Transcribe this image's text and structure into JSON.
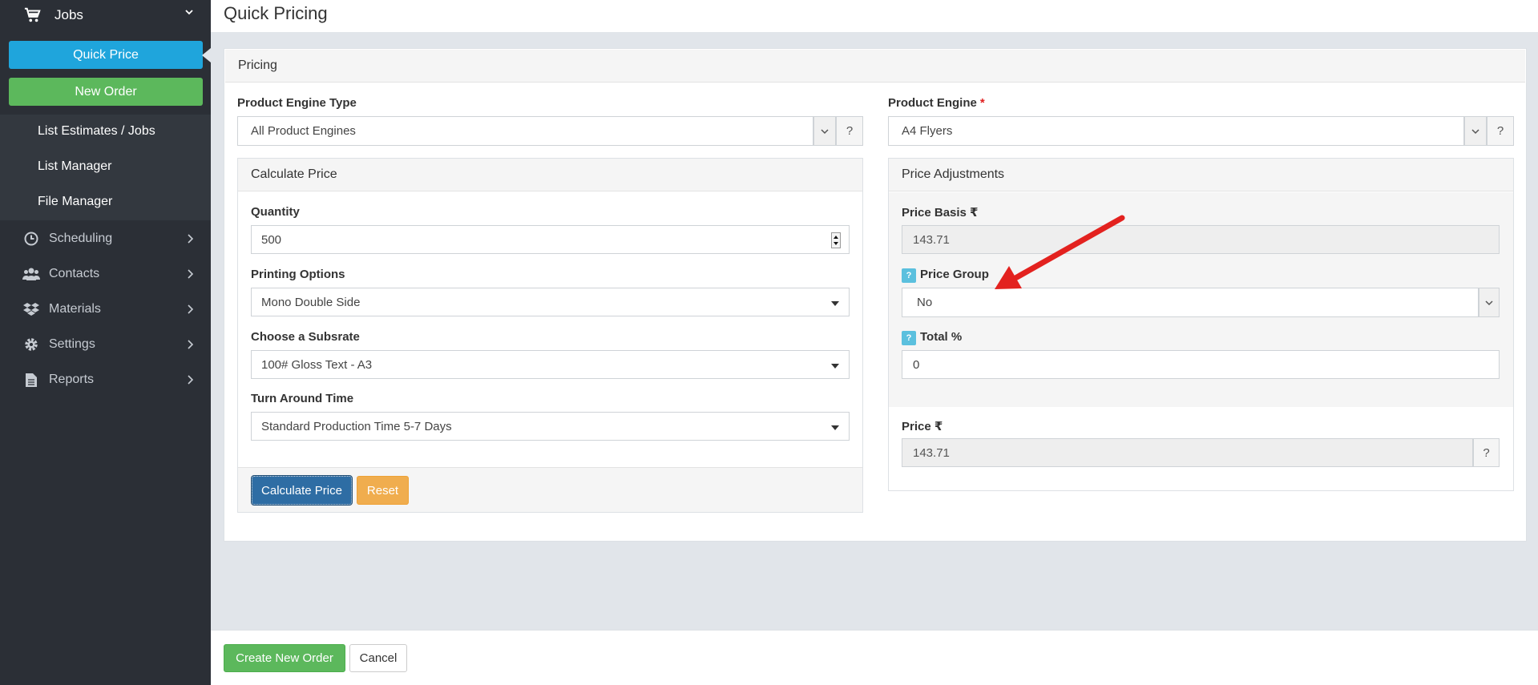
{
  "sidebar": {
    "jobs_label": "Jobs",
    "quick_price_label": "Quick Price",
    "new_order_label": "New Order",
    "sub_items": [
      "List Estimates / Jobs",
      "List Manager",
      "File Manager"
    ],
    "items": [
      {
        "label": "Scheduling",
        "icon": "clock-icon"
      },
      {
        "label": "Contacts",
        "icon": "users-icon"
      },
      {
        "label": "Materials",
        "icon": "dropbox-icon"
      },
      {
        "label": "Settings",
        "icon": "gear-icon"
      },
      {
        "label": "Reports",
        "icon": "document-icon"
      }
    ]
  },
  "header": {
    "title": "Quick Pricing"
  },
  "pricing": {
    "panel_title": "Pricing",
    "engine_type_label": "Product Engine Type",
    "engine_type_value": "All Product Engines",
    "engine_label": "Product Engine",
    "engine_required": "*",
    "engine_value": "A4 Flyers",
    "help_symbol": "?"
  },
  "calculate": {
    "title": "Calculate Price",
    "quantity_label": "Quantity",
    "quantity_value": "500",
    "printing_label": "Printing Options",
    "printing_value": "Mono Double Side",
    "substrate_label": "Choose a Subsrate",
    "substrate_value": "100# Gloss Text - A3",
    "turnaround_label": "Turn Around Time",
    "turnaround_value": "Standard Production Time 5-7 Days",
    "calc_button": "Calculate Price",
    "reset_button": "Reset"
  },
  "adjustments": {
    "title": "Price Adjustments",
    "price_basis_label": "Price Basis ₹",
    "price_basis_value": "143.71",
    "price_group_label": "Price Group",
    "price_group_value": "No",
    "total_label": "Total %",
    "total_value": "0",
    "price_label": "Price ₹",
    "price_value": "143.71",
    "help_badge": "?"
  },
  "footer": {
    "create_button": "Create New Order",
    "cancel_button": "Cancel"
  },
  "colors": {
    "sidebar_bg": "#2b2f36",
    "quick_price": "#1fa5dc",
    "new_order": "#5cb85c",
    "primary": "#2e6da4",
    "warning": "#f0ad4e",
    "info": "#5bc0de",
    "annotation": "#e3221f"
  }
}
